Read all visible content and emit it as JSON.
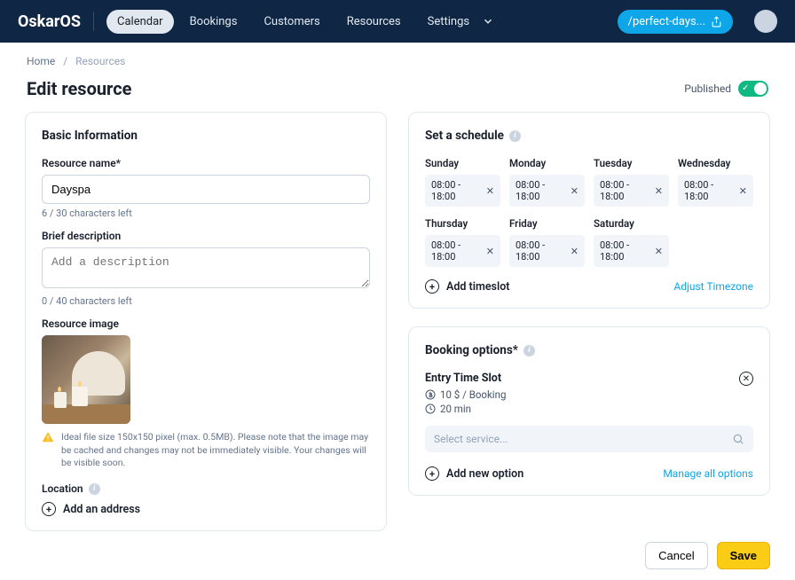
{
  "nav": {
    "brand": "OskarOS",
    "items": [
      "Calendar",
      "Bookings",
      "Customers",
      "Resources",
      "Settings"
    ],
    "active_index": 0,
    "site_pill": "/perfect-days..."
  },
  "breadcrumbs": {
    "home": "Home",
    "current": "Resources"
  },
  "page": {
    "title": "Edit resource",
    "published_label": "Published"
  },
  "basic": {
    "heading": "Basic Information",
    "name_label": "Resource name*",
    "name_value": "Dayspa",
    "name_helper": "6 / 30 characters left",
    "desc_label": "Brief description",
    "desc_placeholder": "Add a description",
    "desc_helper": "0 / 40 characters left",
    "image_label": "Resource image",
    "image_hint": "Ideal file size 150x150 pixel (max. 0.5MB). Please note that the image may be cached and changes may not be immediately visible. Your changes will be visible soon.",
    "location_label": "Location",
    "add_address": "Add an address"
  },
  "schedule": {
    "heading": "Set a schedule",
    "days": [
      {
        "name": "Sunday",
        "slot": "08:00 - 18:00"
      },
      {
        "name": "Monday",
        "slot": "08:00 - 18:00"
      },
      {
        "name": "Tuesday",
        "slot": "08:00 - 18:00"
      },
      {
        "name": "Wednesday",
        "slot": "08:00 - 18:00"
      },
      {
        "name": "Thursday",
        "slot": "08:00 - 18:00"
      },
      {
        "name": "Friday",
        "slot": "08:00 - 18:00"
      },
      {
        "name": "Saturday",
        "slot": "08:00 - 18:00"
      }
    ],
    "add_timeslot": "Add timeslot",
    "adjust_tz": "Adjust Timezone"
  },
  "booking": {
    "heading": "Booking options*",
    "option_title": "Entry Time Slot",
    "option_price": "10 $ / Booking",
    "option_duration": "20 min",
    "select_placeholder": "Select service...",
    "add_new": "Add new option",
    "manage_all": "Manage all options"
  },
  "footer": {
    "cancel": "Cancel",
    "save": "Save"
  }
}
